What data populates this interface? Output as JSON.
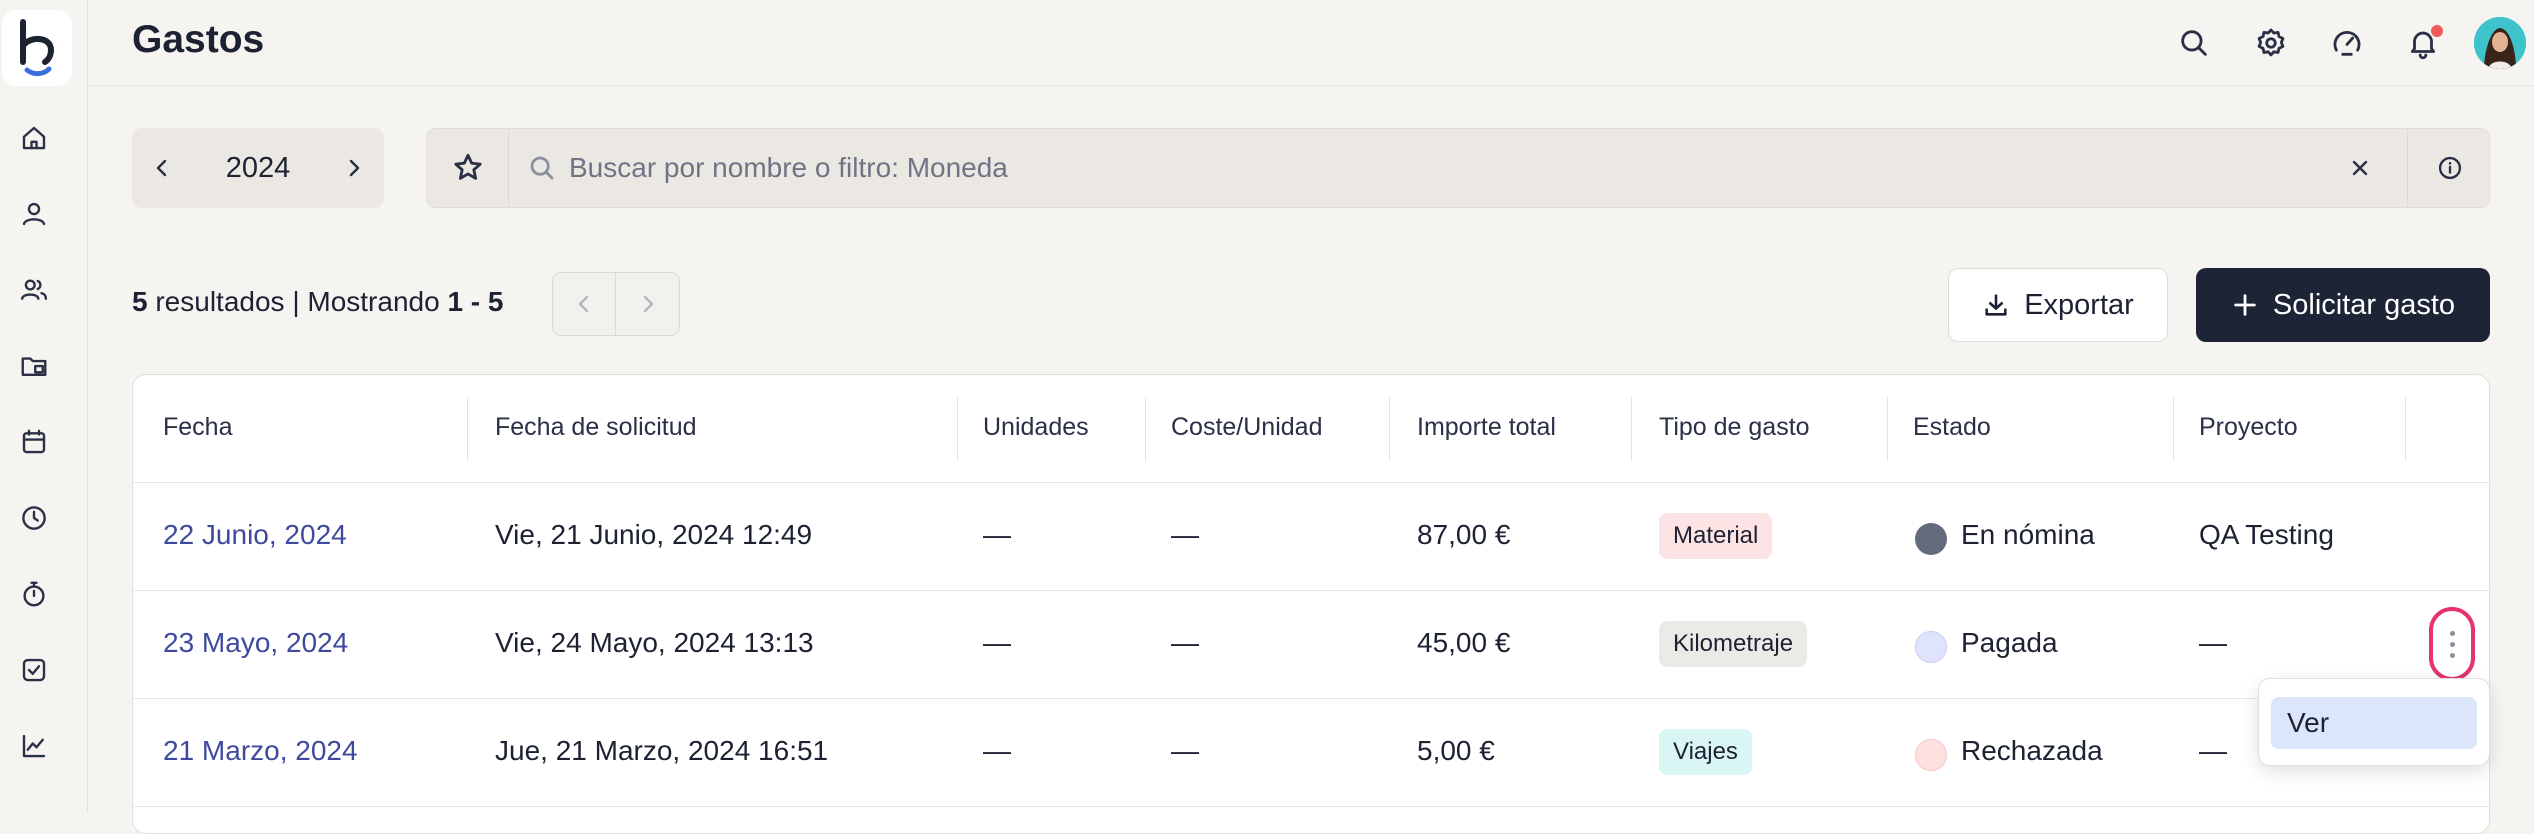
{
  "header": {
    "title": "Gastos"
  },
  "year_selector": {
    "value": "2024"
  },
  "search": {
    "placeholder": "Buscar por nombre o filtro: Moneda"
  },
  "results": {
    "count": "5",
    "count_label": " resultados | Mostrando ",
    "range": "1 - 5"
  },
  "actions": {
    "export_label": "Exportar",
    "request_label": "Solicitar gasto"
  },
  "table": {
    "columns": [
      "Fecha",
      "Fecha de solicitud",
      "Unidades",
      "Coste/Unidad",
      "Importe total",
      "Tipo de gasto",
      "Estado",
      "Proyecto"
    ],
    "rows": [
      {
        "fecha": "22 Junio, 2024",
        "solicitud": "Vie, 21 Junio, 2024 12:49",
        "unidades": "—",
        "coste": "—",
        "importe": "87,00 €",
        "tipo": "Material",
        "estado": "En nómina",
        "proyecto": "QA Testing"
      },
      {
        "fecha": "23 Mayo, 2024",
        "solicitud": "Vie, 24 Mayo, 2024 13:13",
        "unidades": "—",
        "coste": "—",
        "importe": "45,00 €",
        "tipo": "Kilometraje",
        "estado": "Pagada",
        "proyecto": "—"
      },
      {
        "fecha": "21 Marzo, 2024",
        "solicitud": "Jue, 21 Marzo, 2024 16:51",
        "unidades": "—",
        "coste": "—",
        "importe": "5,00 €",
        "tipo": "Viajes",
        "estado": "Rechazada",
        "proyecto": "—"
      }
    ]
  },
  "row_menu": {
    "items": [
      "Ver"
    ]
  },
  "colors": {
    "accent_dark": "#1c2436",
    "link": "#3f4a9e",
    "highlight": "#e5336d",
    "tag_material": "#fde4e4",
    "tag_kilometraje": "#eceae6",
    "tag_viajes": "#d9f5f4",
    "status_en_nomina": "#646b7d",
    "status_pagada": "#dfe3fb",
    "status_rechazada": "#fde0e0"
  },
  "icons": {
    "sidebar": [
      "home-icon",
      "person-icon",
      "people-icon",
      "folder-icon",
      "calendar-icon",
      "clock-icon",
      "stopwatch-icon",
      "check-square-icon",
      "chart-line-icon"
    ],
    "topbar": [
      "search-icon",
      "gear-icon",
      "speedometer-icon",
      "bell-icon"
    ]
  }
}
